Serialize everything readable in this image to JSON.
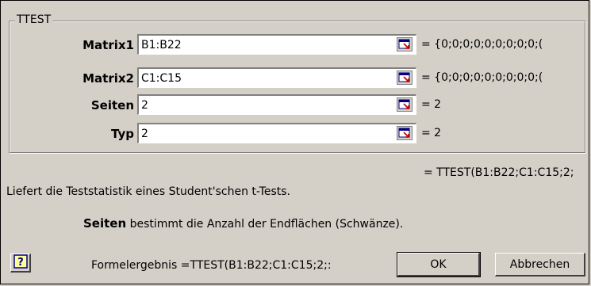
{
  "dialog": {
    "group_title": "TTEST",
    "arguments": [
      {
        "label": "Matrix1",
        "value": "B1:B22",
        "result": "= {0;0;0;0;0;0;0;0;0;("
      },
      {
        "label": "Matrix2",
        "value": "C1:C15",
        "result": "= {0;0;0;0;0;0;0;0;0;("
      },
      {
        "label": "Seiten",
        "value": "2",
        "result": "= 2"
      },
      {
        "label": "Typ",
        "value": "2",
        "result": "= 2"
      }
    ],
    "formula_result_right": "= TTEST(B1:B22;C1:C15;2;",
    "description": "Liefert die Teststatistik eines Student'schen t-Tests.",
    "arg_desc_name": "Seiten",
    "arg_desc_text": "bestimmt die Anzahl der Endflächen (Schwänze).",
    "formula_label": "Formelergebnis =TTEST(B1:B22;C1:C15;2;:",
    "help_icon": "help-icon",
    "ok_label": "OK",
    "cancel_label": "Abbrechen"
  }
}
